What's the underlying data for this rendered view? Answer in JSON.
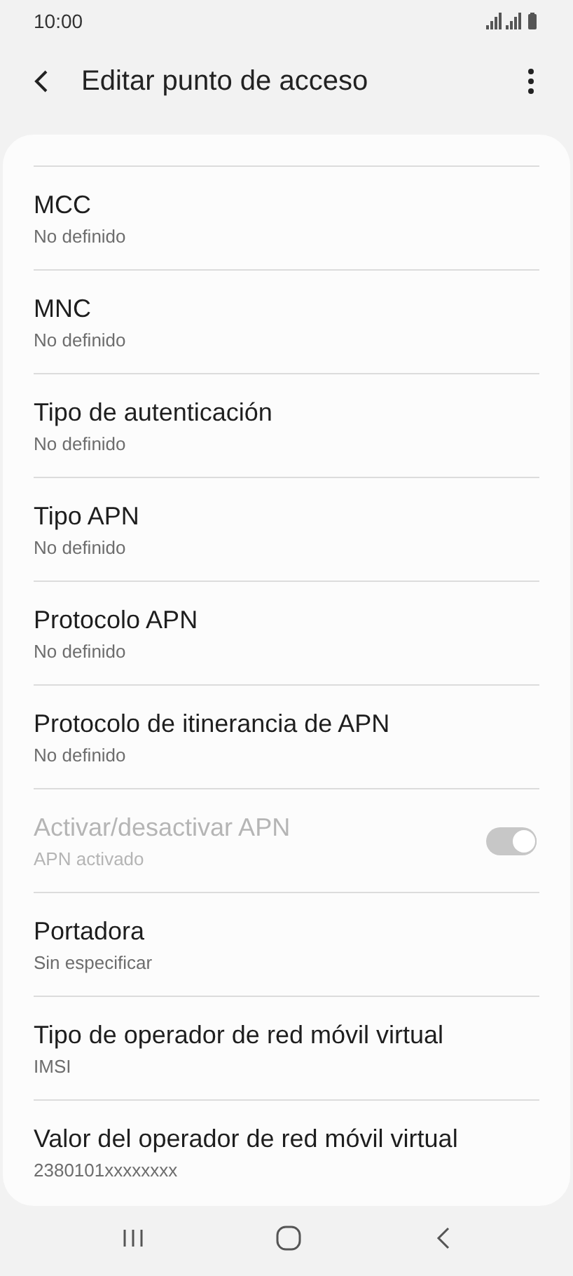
{
  "status_bar": {
    "time": "10:00"
  },
  "header": {
    "title": "Editar punto de acceso"
  },
  "items": [
    {
      "kind": "text",
      "title": "MCC",
      "value": "No definido",
      "disabled": false
    },
    {
      "kind": "text",
      "title": "MNC",
      "value": "No definido",
      "disabled": false
    },
    {
      "kind": "text",
      "title": "Tipo de autenticación",
      "value": "No definido",
      "disabled": false
    },
    {
      "kind": "text",
      "title": "Tipo APN",
      "value": "No definido",
      "disabled": false
    },
    {
      "kind": "text",
      "title": "Protocolo APN",
      "value": "No definido",
      "disabled": false
    },
    {
      "kind": "text",
      "title": "Protocolo de itinerancia de APN",
      "value": "No definido",
      "disabled": false
    },
    {
      "kind": "toggle",
      "title": "Activar/desactivar APN",
      "value": "APN activado",
      "disabled": true,
      "on": true
    },
    {
      "kind": "text",
      "title": "Portadora",
      "value": "Sin especificar",
      "disabled": false
    },
    {
      "kind": "text",
      "title": "Tipo de operador de red móvil virtual",
      "value": "IMSI",
      "disabled": false
    },
    {
      "kind": "text",
      "title": "Valor del operador de red móvil virtual",
      "value": "2380101xxxxxxxx",
      "disabled": false
    }
  ]
}
